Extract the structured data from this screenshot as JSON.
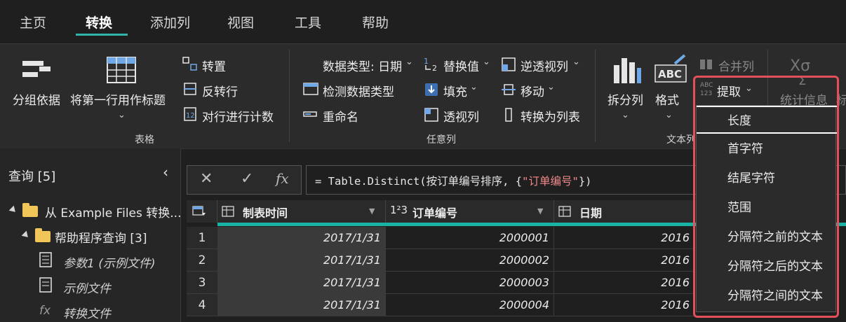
{
  "menu_tabs": [
    "主页",
    "转换",
    "添加列",
    "视图",
    "工具",
    "帮助"
  ],
  "ribbon": {
    "table_group": {
      "group_by": "分组依据",
      "use_first_row": "将第一行用作标题",
      "transpose": "转置",
      "reverse_rows": "反转行",
      "count_rows": "对行进行计数",
      "title": "表格"
    },
    "any_column_group": {
      "data_type": "数据类型: 日期",
      "detect_type": "检测数据类型",
      "rename": "重命名",
      "replace_values": "替换值",
      "fill": "填充",
      "pivot_column": "透视列",
      "unpivot": "逆透视列",
      "move": "移动",
      "convert_to_list": "转换为列表",
      "title": "任意列"
    },
    "text_group": {
      "split_column": "拆分列",
      "format": "格式",
      "merge_columns": "合并列",
      "extract": "提取",
      "title": "文本列"
    },
    "number_group": {
      "statistics": "统计信息",
      "standard": "标"
    }
  },
  "queries": {
    "title": "查询 [5]",
    "items": [
      {
        "label": "从 Example Files 转换..."
      },
      {
        "label": "帮助程序查询 [3]"
      },
      {
        "label": "参数1 (示例文件)"
      },
      {
        "label": "示例文件"
      },
      {
        "label": "转换文件"
      }
    ]
  },
  "formula_bar": {
    "prefix": "= Table.Distinct(按订单编号排序, {",
    "string": "\"订单编号\"",
    "suffix": "})",
    "fx": "fx"
  },
  "grid": {
    "columns": [
      {
        "name": "制表时间",
        "type_icon": "table"
      },
      {
        "name": "订单编号",
        "type_icon": "123"
      },
      {
        "name": "日期",
        "type_icon": "table"
      }
    ],
    "rows": [
      {
        "n": "1",
        "time": "2017/1/31",
        "order": "2000001",
        "date": "2016"
      },
      {
        "n": "2",
        "time": "2017/1/31",
        "order": "2000002",
        "date": "2016"
      },
      {
        "n": "3",
        "time": "2017/1/31",
        "order": "2000003",
        "date": "2016"
      },
      {
        "n": "4",
        "time": "2017/1/31",
        "order": "2000004",
        "date": "2016"
      }
    ]
  },
  "extract_menu": {
    "items": [
      "长度",
      "首字符",
      "结尾字符",
      "范围",
      "分隔符之前的文本",
      "分隔符之后的文本",
      "分隔符之间的文本"
    ]
  },
  "colors": {
    "accent": "#2fb5a9",
    "highlight": "#e4505a"
  }
}
